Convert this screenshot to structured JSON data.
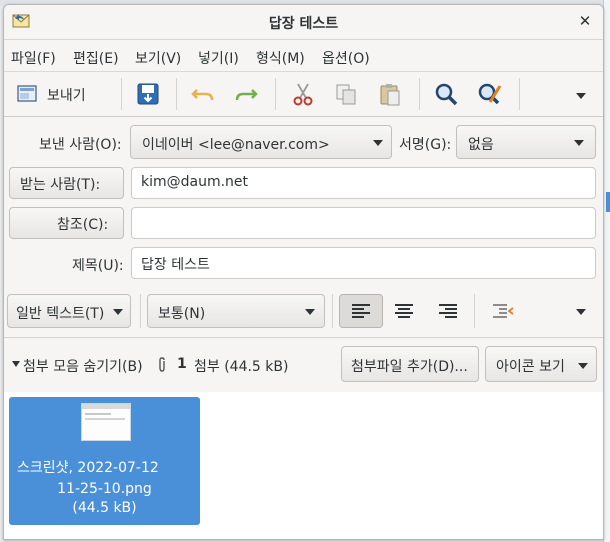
{
  "window": {
    "title": "답장 테스트",
    "close_icon": "close-icon",
    "app_icon": "mail-reply-icon"
  },
  "menu": [
    "파일(F)",
    "편집(E)",
    "보기(V)",
    "넣기(I)",
    "형식(M)",
    "옵션(O)"
  ],
  "toolbar": {
    "send_label": "보내기",
    "icons": [
      "send-icon",
      "save-draft-icon",
      "undo-icon",
      "redo-icon",
      "cut-icon",
      "copy-icon",
      "paste-icon",
      "find-icon",
      "find-replace-icon",
      "overflow-icon"
    ]
  },
  "header": {
    "from_label": "보낸 사람(O):",
    "from_value": "이네이버 <lee@naver.com>",
    "signature_label": "서명(G):",
    "signature_value": "없음",
    "to_label": "받는 사람(T):",
    "to_value": "kim@daum.net",
    "cc_label": "참조(C):",
    "cc_value": "",
    "subject_label": "제목(U):",
    "subject_value": "답장 테스트"
  },
  "format": {
    "mode": "일반 텍스트(T)",
    "paragraph": "보통(N)"
  },
  "attachments": {
    "toggle_label": "첨부 모음 숨기기(B)",
    "count": "1",
    "count_label": "첨부 (44.5 kB)",
    "add_button": "첨부파일 추가(D)...",
    "view_button": "아이콘 보기",
    "items": [
      {
        "line1": "스크린샷, 2022-07-12",
        "line2": "11-25-10.png",
        "line3": "(44.5 kB)"
      }
    ]
  },
  "colors": {
    "selection": "#4a90d9",
    "window_bg": "#f6f5f4"
  }
}
